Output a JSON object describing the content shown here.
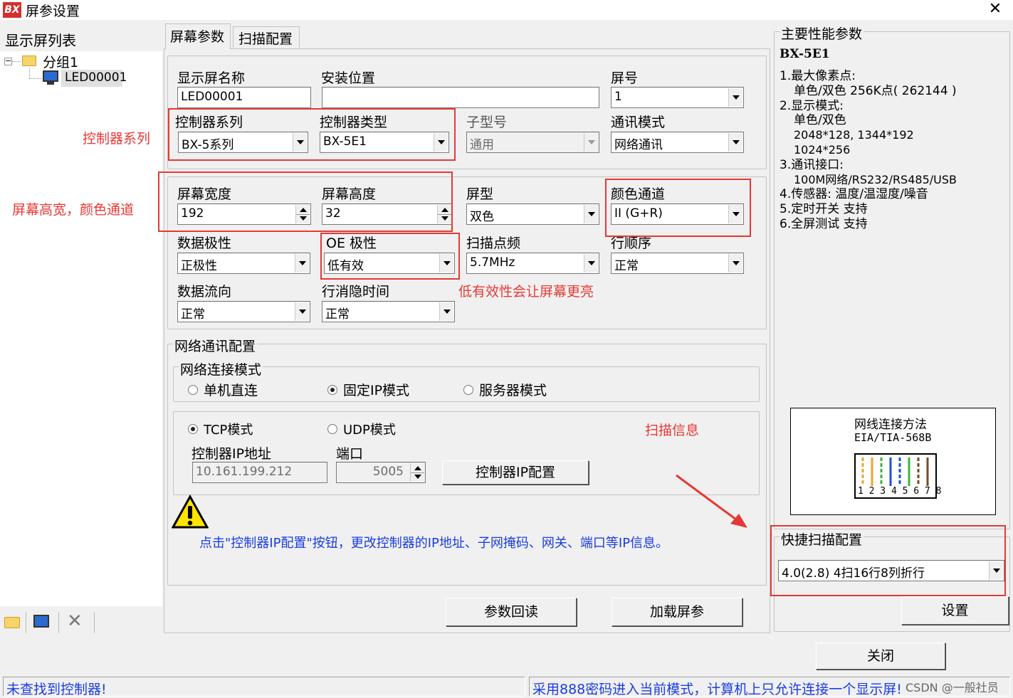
{
  "window": {
    "title": "屏参设置",
    "logo_text": "BX",
    "close_glyph": "✕"
  },
  "left_panel": {
    "header": "显示屏列表",
    "tree": {
      "group": "分组1",
      "screen": "LED00001"
    }
  },
  "tabs": [
    "屏幕参数",
    "扫描配置"
  ],
  "form": {
    "screen_name": {
      "label": "显示屏名称",
      "value": "LED00001"
    },
    "install_location": {
      "label": "安装位置",
      "value": ""
    },
    "screen_number": {
      "label": "屏号",
      "value": "1"
    },
    "controller_series": {
      "label": "控制器系列",
      "value": "BX-5系列"
    },
    "controller_type": {
      "label": "控制器类型",
      "value": "BX-5E1"
    },
    "sub_model": {
      "label": "子型号",
      "value": "通用"
    },
    "comm_mode": {
      "label": "通讯模式",
      "value": "网络通讯"
    },
    "screen_width": {
      "label": "屏幕宽度",
      "value": "192"
    },
    "screen_height": {
      "label": "屏幕高度",
      "value": "32"
    },
    "screen_type": {
      "label": "屏型",
      "value": "双色"
    },
    "color_channel": {
      "label": "颜色通道",
      "value": "II (G+R)"
    },
    "data_polarity": {
      "label": "数据极性",
      "value": "正极性"
    },
    "oe_polarity": {
      "label": "OE 极性",
      "value": "低有效"
    },
    "scan_freq": {
      "label": "扫描点频",
      "value": "5.7MHz"
    },
    "row_order": {
      "label": "行顺序",
      "value": "正常"
    },
    "data_flow": {
      "label": "数据流向",
      "value": "正常"
    },
    "blanking_time": {
      "label": "行消隐时间",
      "value": "正常"
    }
  },
  "network": {
    "title": "网络通讯配置",
    "connect_mode_title": "网络连接模式",
    "modes": [
      "单机直连",
      "固定IP模式",
      "服务器模式"
    ],
    "selected_mode": "固定IP模式",
    "protocols": [
      "TCP模式",
      "UDP模式"
    ],
    "selected_protocol": "TCP模式",
    "ip_label": "控制器IP地址",
    "ip_value": "10.161.199.212",
    "port_label": "端口",
    "port_value": "5005",
    "ip_config_button": "控制器IP配置",
    "hint": "点击\"控制器IP配置\"按钮，更改控制器的IP地址、子网掩码、网关、端口等IP信息。"
  },
  "buttons": {
    "read_back": "参数回读",
    "load": "加载屏参",
    "set": "设置",
    "close": "关闭"
  },
  "perf": {
    "title": "主要性能参数",
    "model": "BX-5E1",
    "lines": [
      "1.最大像素点:",
      "单色/双色 256K点( 262144 )",
      "2.显示模式:",
      "单色/双色",
      "2048*128, 1344*192",
      "1024*256",
      "3.通讯接口:",
      "100M网络/RS232/RS485/USB",
      "4.传感器: 温度/温湿度/噪音",
      "5.定时开关 支持",
      "6.全屏测试 支持"
    ],
    "wiring_title": "网线连接方法",
    "wiring_std": "EIA/TIA-568B",
    "pins": "1 2 3 4 5 6 7 8"
  },
  "quick_scan": {
    "title": "快捷扫描配置",
    "value": "4.0(2.8)  4扫16行8列折行"
  },
  "status": {
    "left": "未查找到控制器!",
    "right": "采用888密码进入当前模式，计算机上只允许连接一个显示屏!",
    "watermark": "CSDN @一般社员"
  },
  "annotations": {
    "controller_series": "控制器系列",
    "size_color": "屏幕高宽，颜色通道",
    "oe_note": "低有效性会让屏幕更亮",
    "scan_info": "扫描信息"
  },
  "colors": {
    "annotation_red": "#e53935",
    "hint_blue": "#1a3de0",
    "window_bg": "#f0f0f0"
  }
}
